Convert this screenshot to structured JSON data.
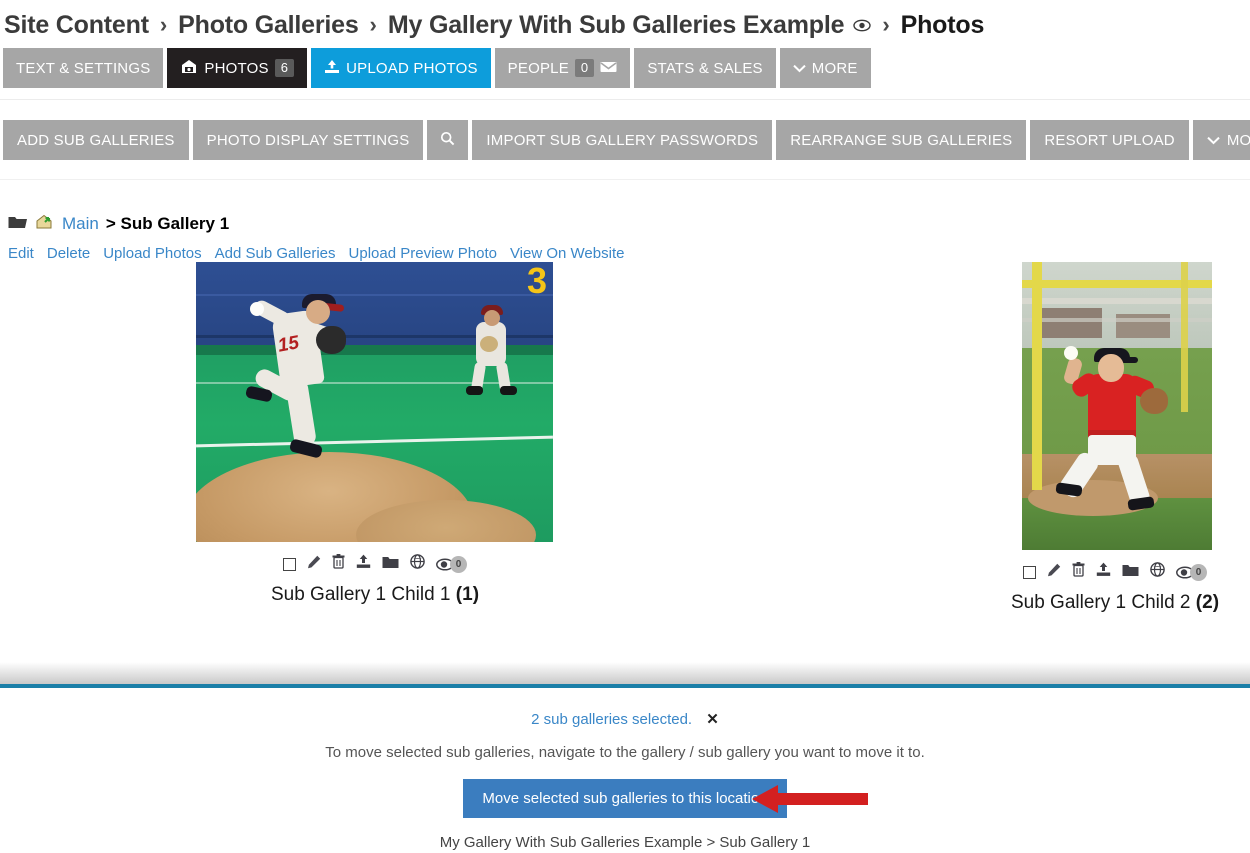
{
  "breadcrumb": {
    "items": [
      {
        "label": "Site Content",
        "type": "link"
      },
      {
        "label": "Photo Galleries",
        "type": "link"
      },
      {
        "label": "My Gallery With Sub Galleries Example",
        "type": "link",
        "has_eye": true
      },
      {
        "label": "Photos",
        "type": "current"
      }
    ],
    "separator": "›"
  },
  "tabs": [
    {
      "label": "TEXT & SETTINGS",
      "style": "gray"
    },
    {
      "label": "PHOTOS",
      "style": "dark",
      "count": "6",
      "icon": "photo-icon"
    },
    {
      "label": "UPLOAD PHOTOS",
      "style": "blue",
      "icon": "upload-icon"
    },
    {
      "label": "PEOPLE",
      "style": "gray",
      "count": "0",
      "trailing_icon": "envelope-icon"
    },
    {
      "label": "STATS & SALES",
      "style": "gray"
    },
    {
      "label": "MORE",
      "style": "gray",
      "icon": "chevron-down-icon"
    }
  ],
  "actions": [
    {
      "label": "ADD SUB GALLERIES"
    },
    {
      "label": "PHOTO DISPLAY SETTINGS"
    },
    {
      "label": "",
      "icon": "search-icon"
    },
    {
      "label": "IMPORT SUB GALLERY PASSWORDS"
    },
    {
      "label": "REARRANGE SUB GALLERIES"
    },
    {
      "label": "RESORT UPLOAD"
    },
    {
      "label": "MORE",
      "icon": "chevron-down-icon"
    }
  ],
  "gallery_path": {
    "folder_icon": "open-folder-icon",
    "house_icon": "house-green-arrow-icon",
    "root": "Main",
    "tail": "> Sub Gallery 1"
  },
  "sub_links": [
    "Edit",
    "Delete",
    "Upload Photos",
    "Add Sub Galleries",
    "Upload Preview Photo",
    "View On Website"
  ],
  "thumbnails": [
    {
      "caption_text": "Sub Gallery 1 Child 1",
      "caption_number": "(1)",
      "views": "0",
      "icons": [
        "select-checkbox",
        "edit-pencil-icon",
        "delete-trash-icon",
        "upload-icon",
        "folder-icon",
        "globe-icon",
        "eye-icon"
      ]
    },
    {
      "caption_text": "Sub Gallery 1 Child 2",
      "caption_number": "(2)",
      "views": "0",
      "icons": [
        "select-checkbox",
        "edit-pencil-icon",
        "delete-trash-icon",
        "upload-icon",
        "folder-icon",
        "globe-icon",
        "eye-icon"
      ]
    }
  ],
  "bottom_panel": {
    "selected_text": "2 sub galleries selected.",
    "close_mark": "✕",
    "instruction": "To move selected sub galleries, navigate to the gallery / sub gallery you want to move it to.",
    "move_button": "Move selected sub galleries to this location",
    "destination_path": "My Gallery With Sub Galleries Example > Sub Gallery 1"
  },
  "colors": {
    "tab_gray": "#a6a6a6",
    "tab_dark": "#231f20",
    "tab_blue": "#0d9ddb",
    "link_blue": "#3a87c8",
    "button_blue": "#3b7dbf",
    "divider_blue": "#1b7fa8",
    "arrow_red": "#d32020"
  }
}
